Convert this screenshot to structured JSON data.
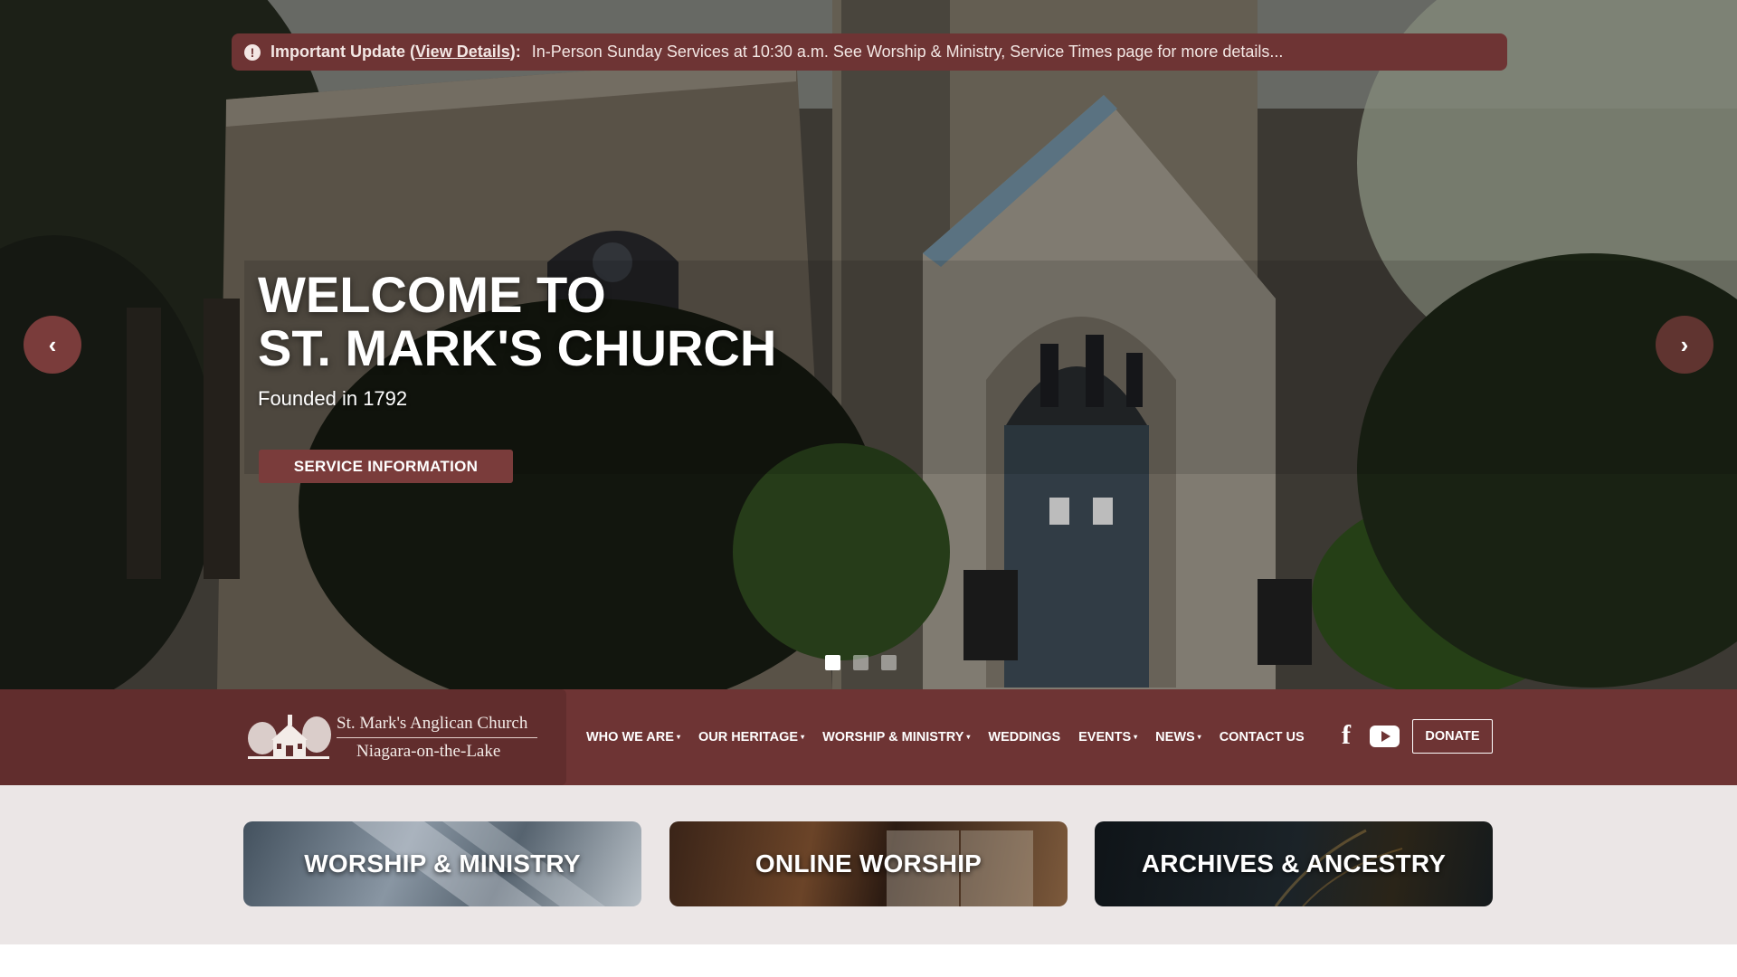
{
  "alert": {
    "lead_prefix": "Important Update (",
    "lead_link": "View Details",
    "lead_suffix": "):",
    "message": "In-Person Sunday Services at 10:30 a.m. See Worship & Ministry, Service Times page for more details..."
  },
  "hero": {
    "title_line1": "WELCOME TO",
    "title_line2": "ST. MARK'S CHURCH",
    "subtitle": "Founded in 1792",
    "button_label": "SERVICE INFORMATION",
    "slide_count": 3,
    "active_slide": 1
  },
  "brand": {
    "line1": "St. Mark's Anglican Church",
    "line2": "Niagara-on-the-Lake"
  },
  "nav": {
    "items": [
      {
        "label": "WHO WE ARE",
        "dropdown": true
      },
      {
        "label": "OUR HERITAGE",
        "dropdown": true
      },
      {
        "label": "WORSHIP & MINISTRY",
        "dropdown": true
      },
      {
        "label": "WEDDINGS",
        "dropdown": false
      },
      {
        "label": "EVENTS",
        "dropdown": true
      },
      {
        "label": "NEWS",
        "dropdown": true
      },
      {
        "label": "CONTACT US",
        "dropdown": false
      }
    ],
    "caret_glyph": "▾",
    "facebook_glyph": "f",
    "donate_label": "DONATE"
  },
  "quicklinks": {
    "worship": "WORSHIP & MINISTRY",
    "online": "ONLINE WORSHIP",
    "archives": "ARCHIVES & ANCESTRY"
  },
  "colors": {
    "brand_maroon": "#6e3434",
    "brand_dark": "#612d2d",
    "button": "#7a3c3b",
    "band_bg": "#ebe6e6"
  },
  "icons": {
    "prev": "chevron-left-icon",
    "next": "chevron-right-icon",
    "alert": "info-icon",
    "social": [
      "facebook-icon",
      "youtube-icon"
    ]
  }
}
